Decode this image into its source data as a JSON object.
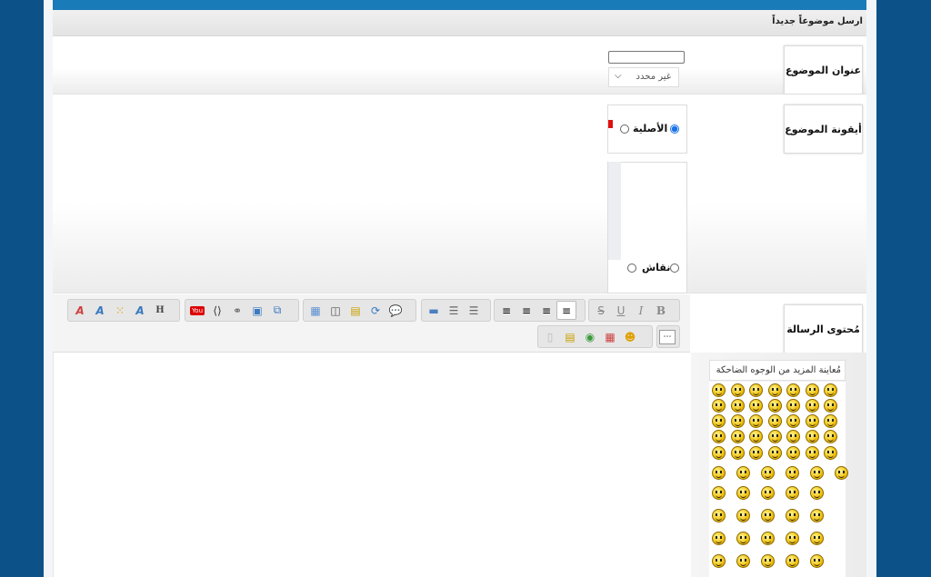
{
  "header": {
    "breadcrumb": "ارسل موضوعاً جديداً"
  },
  "subject": {
    "label": "عنوان الموضوع",
    "input_value": "",
    "prefix_select": "غير محدد"
  },
  "topic_icon": {
    "label": "أيقونة الموضوع",
    "options": [
      {
        "label": "الأصلية",
        "selected": true
      },
      {
        "label": "نقاش",
        "selected": false
      }
    ]
  },
  "message": {
    "label": "مُحتوى الرسالة"
  },
  "toolbar": {
    "buttons": [
      {
        "name": "bold",
        "glyph": "B"
      },
      {
        "name": "italic",
        "glyph": "I"
      },
      {
        "name": "underline",
        "glyph": "U"
      },
      {
        "name": "strikethrough",
        "glyph": "S"
      },
      {
        "name": "align-right",
        "glyph": "≡"
      },
      {
        "name": "align-center",
        "glyph": "≡"
      },
      {
        "name": "align-left",
        "glyph": "≡"
      },
      {
        "name": "justify",
        "glyph": "≡"
      },
      {
        "name": "heading",
        "glyph": "H"
      }
    ]
  },
  "smilies": {
    "more_link": "مُعاينة المزيد من الوجوه الضاحكة"
  }
}
